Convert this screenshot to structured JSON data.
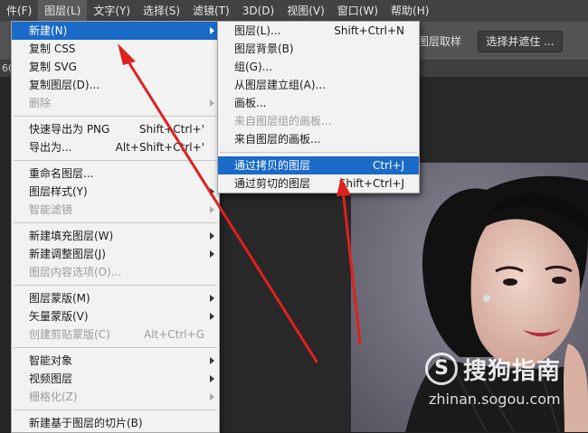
{
  "menubar": {
    "items": [
      {
        "label": "件(F)",
        "active": false
      },
      {
        "label": "图层(L)",
        "active": true
      },
      {
        "label": "文字(Y)",
        "active": false
      },
      {
        "label": "选择(S)",
        "active": false
      },
      {
        "label": "滤镜(T)",
        "active": false
      },
      {
        "label": "3D(D)",
        "active": false
      },
      {
        "label": "视图(V)",
        "active": false
      },
      {
        "label": "窗口(W)",
        "active": false
      },
      {
        "label": "帮助(H)",
        "active": false
      }
    ]
  },
  "options_bar": {
    "label": "图层取样",
    "button": "选择并遮住 ..."
  },
  "tab_strip": {
    "fragment": "60"
  },
  "layer_menu": {
    "items": [
      {
        "type": "item",
        "label": "新建(N)",
        "submenu": true,
        "highlight": true
      },
      {
        "type": "item",
        "label": "复制 CSS"
      },
      {
        "type": "item",
        "label": "复制 SVG"
      },
      {
        "type": "item",
        "label": "复制图层(D)..."
      },
      {
        "type": "item",
        "label": "删除",
        "submenu": true,
        "disabled": true
      },
      {
        "type": "sep"
      },
      {
        "type": "item",
        "label": "快速导出为 PNG",
        "shortcut": "Shift+Ctrl+'"
      },
      {
        "type": "item",
        "label": "导出为...",
        "shortcut": "Alt+Shift+Ctrl+'"
      },
      {
        "type": "sep"
      },
      {
        "type": "item",
        "label": "重命名图层..."
      },
      {
        "type": "item",
        "label": "图层样式(Y)",
        "submenu": true
      },
      {
        "type": "item",
        "label": "智能滤镜",
        "submenu": true,
        "disabled": true
      },
      {
        "type": "sep"
      },
      {
        "type": "item",
        "label": "新建填充图层(W)",
        "submenu": true
      },
      {
        "type": "item",
        "label": "新建调整图层(J)",
        "submenu": true
      },
      {
        "type": "item",
        "label": "图层内容选项(O)...",
        "disabled": true
      },
      {
        "type": "sep"
      },
      {
        "type": "item",
        "label": "图层蒙版(M)",
        "submenu": true
      },
      {
        "type": "item",
        "label": "矢量蒙版(V)",
        "submenu": true
      },
      {
        "type": "item",
        "label": "创建剪贴蒙版(C)",
        "shortcut": "Alt+Ctrl+G",
        "disabled": true
      },
      {
        "type": "sep"
      },
      {
        "type": "item",
        "label": "智能对象",
        "submenu": true
      },
      {
        "type": "item",
        "label": "视频图层",
        "submenu": true
      },
      {
        "type": "item",
        "label": "栅格化(Z)",
        "submenu": true,
        "disabled": true
      },
      {
        "type": "sep"
      },
      {
        "type": "item",
        "label": "新建基于图层的切片(B)"
      }
    ]
  },
  "new_submenu": {
    "items": [
      {
        "type": "item",
        "label": "图层(L)...",
        "shortcut": "Shift+Ctrl+N"
      },
      {
        "type": "item",
        "label": "图层背景(B)"
      },
      {
        "type": "item",
        "label": "组(G)..."
      },
      {
        "type": "item",
        "label": "从图层建立组(A)..."
      },
      {
        "type": "item",
        "label": "画板..."
      },
      {
        "type": "item",
        "label": "来自图层组的画板...",
        "disabled": true
      },
      {
        "type": "item",
        "label": "来自图层的画板..."
      },
      {
        "type": "sep"
      },
      {
        "type": "item",
        "label": "通过拷贝的图层",
        "shortcut": "Ctrl+J",
        "highlight": true
      },
      {
        "type": "item",
        "label": "通过剪切的图层",
        "shortcut": "Shift+Ctrl+J"
      }
    ]
  },
  "watermark": {
    "logo_glyph": "S",
    "title": "搜狗指南",
    "url": "zhinan.sogou.com"
  },
  "colors": {
    "menubar": "#424242",
    "options_bar": "#535353",
    "menu_bg": "#f2f2f2",
    "highlight": "#1a6ac8",
    "annotation_arrow": "#e02020"
  }
}
